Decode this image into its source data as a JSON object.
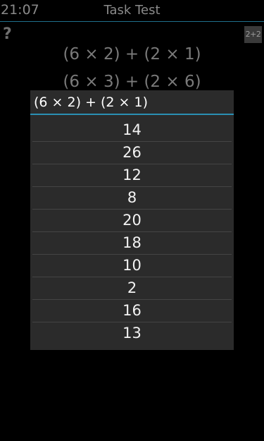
{
  "status_bar": {
    "time": "21:07"
  },
  "header": {
    "title": "Task Test"
  },
  "toolbar": {
    "help_label": "?",
    "badge_label": "2+2"
  },
  "background": {
    "expressions": [
      "(6 × 2) + (2 × 1)",
      "(6 × 3) + (2 × 6)"
    ]
  },
  "dialog": {
    "title": "(6 × 2) + (2 × 1)",
    "options": [
      "14",
      "26",
      "12",
      "8",
      "20",
      "18",
      "10",
      "2",
      "16",
      "13"
    ]
  }
}
